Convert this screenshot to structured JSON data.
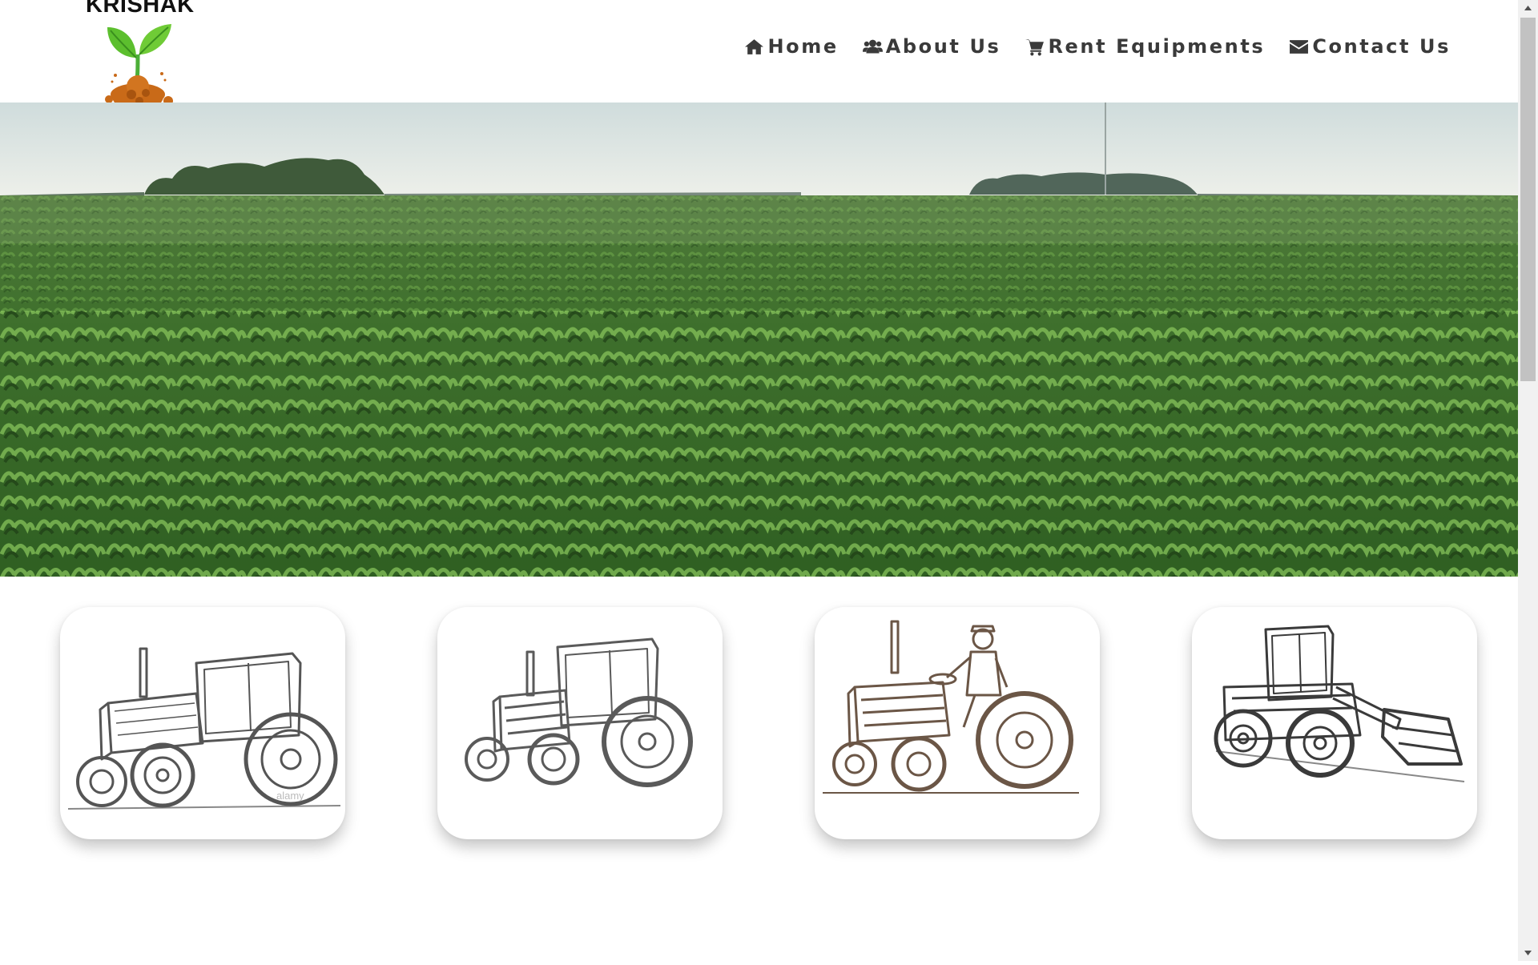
{
  "header": {
    "brand": "KRISHAK",
    "logo_icon": "sprout-logo-icon"
  },
  "nav": {
    "items": [
      {
        "label": "Home",
        "icon": "home-icon"
      },
      {
        "label": "About Us",
        "icon": "users-icon"
      },
      {
        "label": "Rent Equipments",
        "icon": "cart-icon"
      },
      {
        "label": "Contact Us",
        "icon": "envelope-icon"
      }
    ]
  },
  "hero": {
    "image": "green crop field under pale sky"
  },
  "cards": [
    {
      "name": "tractor-cab-sketch",
      "image_text": "alamy"
    },
    {
      "name": "vintage-tractor-sketch"
    },
    {
      "name": "farmer-on-tractor-sketch"
    },
    {
      "name": "front-loader-sketch"
    }
  ],
  "colors": {
    "nav_text": "#3a3a3a",
    "field_dark": "#2e5a22",
    "field_light": "#6fa64a",
    "sketch_gray": "#555555",
    "sketch_brown": "#6b5646"
  }
}
